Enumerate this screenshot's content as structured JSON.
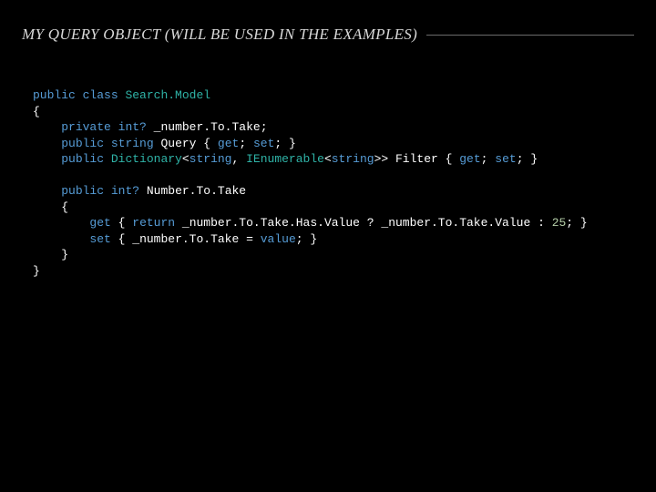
{
  "title": "MY QUERY OBJECT (WILL BE USED IN THE EXAMPLES)",
  "code": {
    "kw_public": "public",
    "kw_class": "class",
    "kw_private": "private",
    "kw_get": "get",
    "kw_set": "set",
    "kw_return": "return",
    "kw_value": "value",
    "t_int_nullable": "int?",
    "t_string": "string",
    "t_dict": "Dictionary",
    "t_ienum": "IEnumerable",
    "cls_name": "Search.Model",
    "fld_number": "_number.To.Take",
    "prop_query": "Query",
    "prop_filter": "Filter",
    "prop_number": "Number.To.Take",
    "hasvalue": "Has.Value",
    "value_suffix": "Value",
    "lit_25": "25",
    "brace_open": "{",
    "brace_close": "}",
    "semi": ";",
    "lt": "<",
    "gt": ">",
    "comma": ",",
    "qmark": "?",
    "colon": ":",
    "eq": "=",
    "dot": ".",
    "sp": " "
  }
}
